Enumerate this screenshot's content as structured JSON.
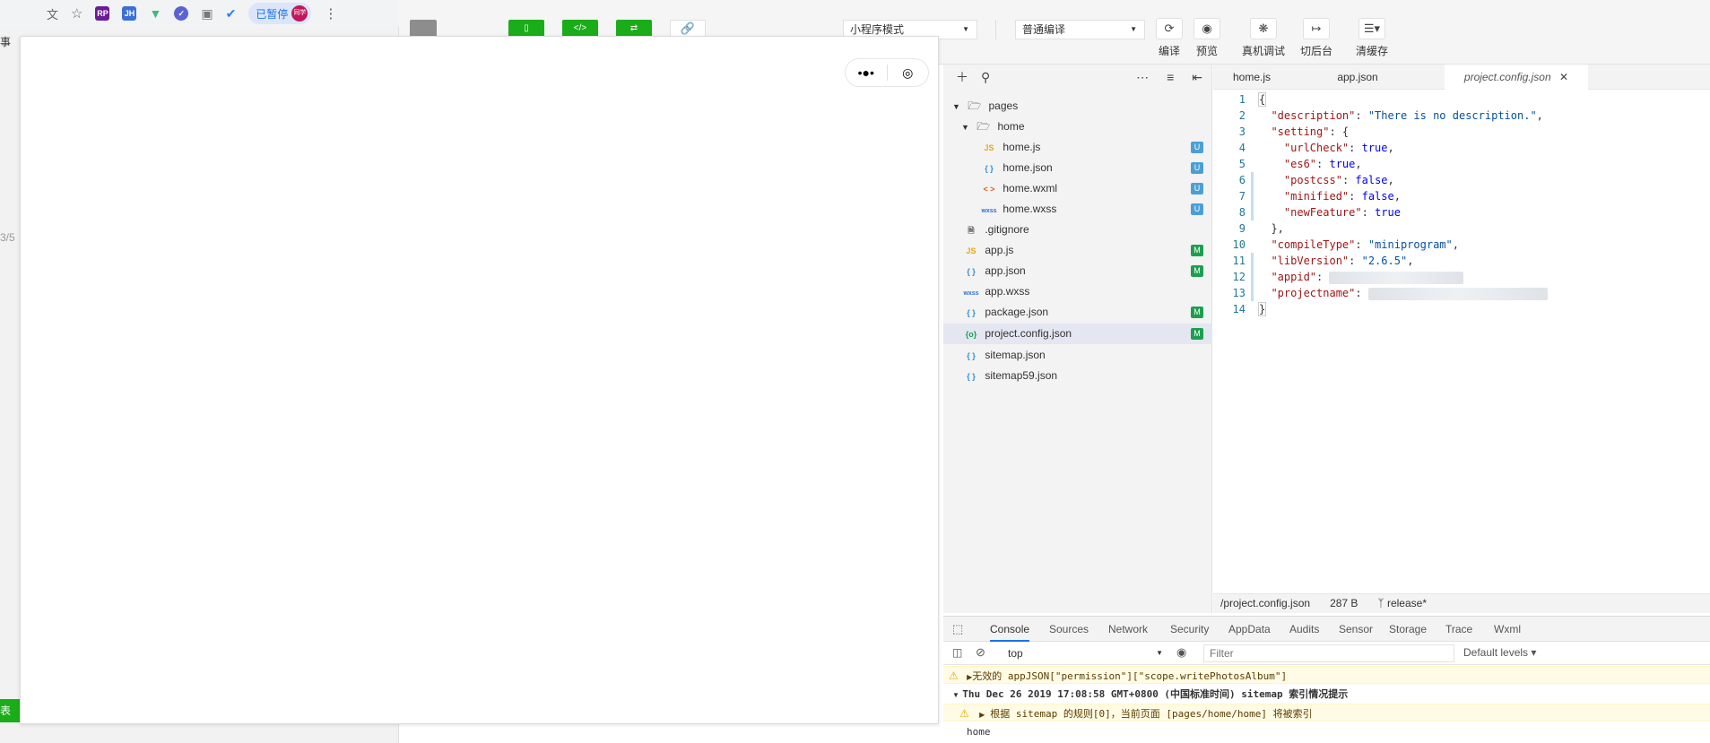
{
  "browser": {
    "paused_label": "已暂停",
    "avatar_text": "同学",
    "ext_jh": "JH",
    "ext_rp": "RP"
  },
  "side_fragments": {
    "f1": "事",
    "f2": "3/5",
    "f3": "表"
  },
  "toolbar": {
    "mode_select": "小程序模式",
    "compile_select": "普通编译",
    "compile_label": "编译",
    "preview_label": "预览",
    "remote_debug_label": "真机调试",
    "background_label": "切后台",
    "clear_cache_label": "清缓存"
  },
  "explorer": {
    "items": [
      {
        "label": "pages",
        "badge": ""
      },
      {
        "label": "home",
        "badge": ""
      },
      {
        "label": "home.js",
        "icon": "JS",
        "badge": "U"
      },
      {
        "label": "home.json",
        "icon": "{ }",
        "badge": "U"
      },
      {
        "label": "home.wxml",
        "icon": "< >",
        "badge": "U"
      },
      {
        "label": "home.wxss",
        "icon": "wxss",
        "badge": "U"
      },
      {
        "label": ".gitignore",
        "badge": ""
      },
      {
        "label": "app.js",
        "icon": "JS",
        "badge": "M"
      },
      {
        "label": "app.json",
        "icon": "{ }",
        "badge": "M"
      },
      {
        "label": "app.wxss",
        "icon": "wxss",
        "badge": ""
      },
      {
        "label": "package.json",
        "icon": "{ }",
        "badge": "M"
      },
      {
        "label": "project.config.json",
        "icon": "{o}",
        "badge": "M"
      },
      {
        "label": "sitemap.json",
        "icon": "{ }",
        "badge": ""
      },
      {
        "label": "sitemap59.json",
        "icon": "{ }",
        "badge": ""
      }
    ]
  },
  "editor": {
    "tabs": [
      "home.js",
      "app.json",
      "project.config.json"
    ],
    "code": {
      "l1": "{",
      "l2k": "\"description\"",
      "l2v": "\"There is no description.\"",
      "l3k": "\"setting\"",
      "l4k": "\"urlCheck\"",
      "l4v": "true",
      "l5k": "\"es6\"",
      "l5v": "true",
      "l6k": "\"postcss\"",
      "l6v": "false",
      "l7k": "\"minified\"",
      "l7v": "false",
      "l8k": "\"newFeature\"",
      "l8v": "true",
      "l9": "},",
      "l10k": "\"compileType\"",
      "l10v": "\"miniprogram\"",
      "l11k": "\"libVersion\"",
      "l11v": "\"2.6.5\"",
      "l12k": "\"appid\"",
      "l13k": "\"projectname\"",
      "l14": "}"
    },
    "status": {
      "path": "/project.config.json",
      "size": "287 B",
      "branch": "release*"
    }
  },
  "console": {
    "tabs": [
      "Console",
      "Sources",
      "Network",
      "Security",
      "AppData",
      "Audits",
      "Sensor",
      "Storage",
      "Trace",
      "Wxml"
    ],
    "context": "top",
    "filter_placeholder": "Filter",
    "levels": "Default levels",
    "messages": {
      "m1": "无效的 appJSON[\"permission\"][\"scope.writePhotosAlbum\"]",
      "m2": "Thu Dec 26 2019 17:08:58 GMT+0800 (中国标准时间) sitemap 索引情况提示",
      "m3": "根据 sitemap 的规则[0]，当前页面 [pages/home/home] 将被索引",
      "m4": "home"
    }
  },
  "colors": {
    "green": "#1aad19",
    "badge_untracked": "#4b9fd5",
    "badge_modified": "#1e9e4f"
  }
}
